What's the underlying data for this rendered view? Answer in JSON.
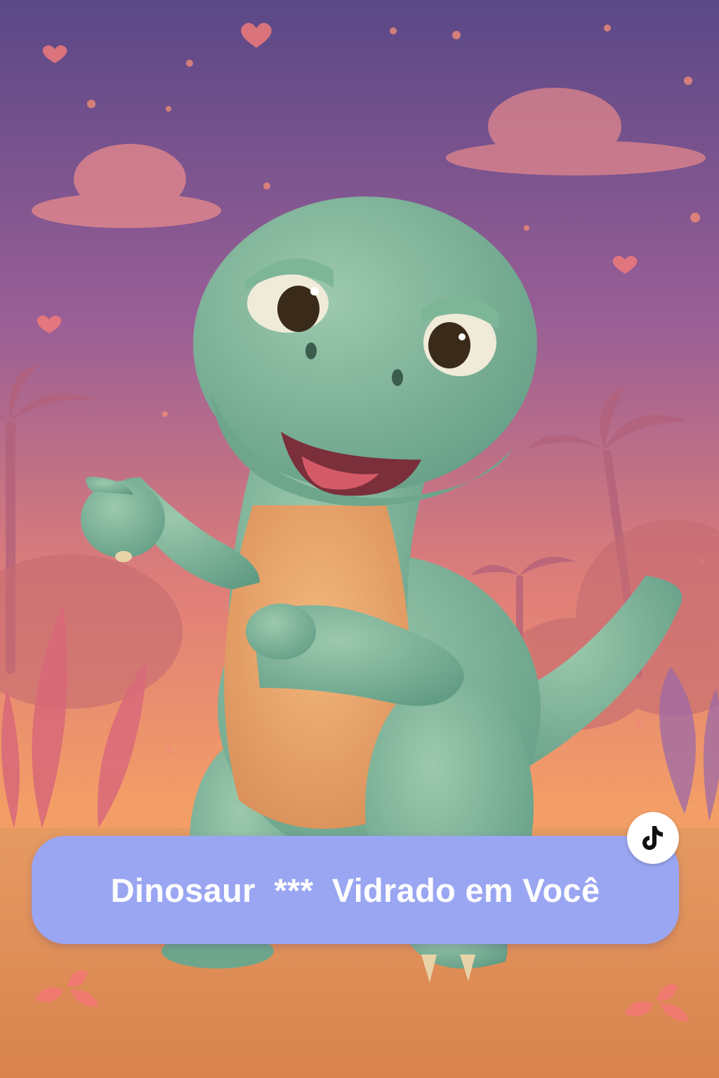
{
  "caption": {
    "text": "Dinosaur  ***  Vidrado em Você"
  },
  "icons": {
    "badge": "tiktok-logo-icon"
  },
  "colors": {
    "caption_bg": "#9aa6f2",
    "caption_text": "#ffffff",
    "sky_top": "#5b4a8a",
    "sky_bottom": "#f4a065",
    "dino_skin": "#7fb59a",
    "dino_belly": "#e9a56a"
  }
}
